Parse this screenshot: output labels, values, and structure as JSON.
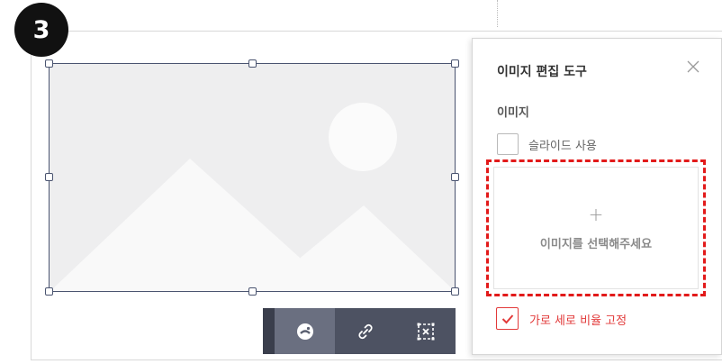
{
  "step_badge": "3",
  "panel": {
    "title": "이미지 편집 도구",
    "section_label": "이미지",
    "slide_option": {
      "label": "슬라이드 사용",
      "checked": false
    },
    "dropzone": {
      "plus": "+",
      "text": "이미지를 선택해주세요"
    },
    "aspect_ratio_option": {
      "label": "가로 세로 비율 고정",
      "checked": true
    }
  },
  "toolbar": {
    "buttons": [
      {
        "icon": "image-style-icon",
        "active": true
      },
      {
        "icon": "link-icon",
        "active": false
      },
      {
        "icon": "remove-image-icon",
        "active": false
      }
    ]
  },
  "colors": {
    "highlight_dash": "#e21a1a",
    "toolbar_bg": "#4d5262",
    "checkbox_accent": "#e23a3a",
    "image_border": "#4a5470"
  }
}
